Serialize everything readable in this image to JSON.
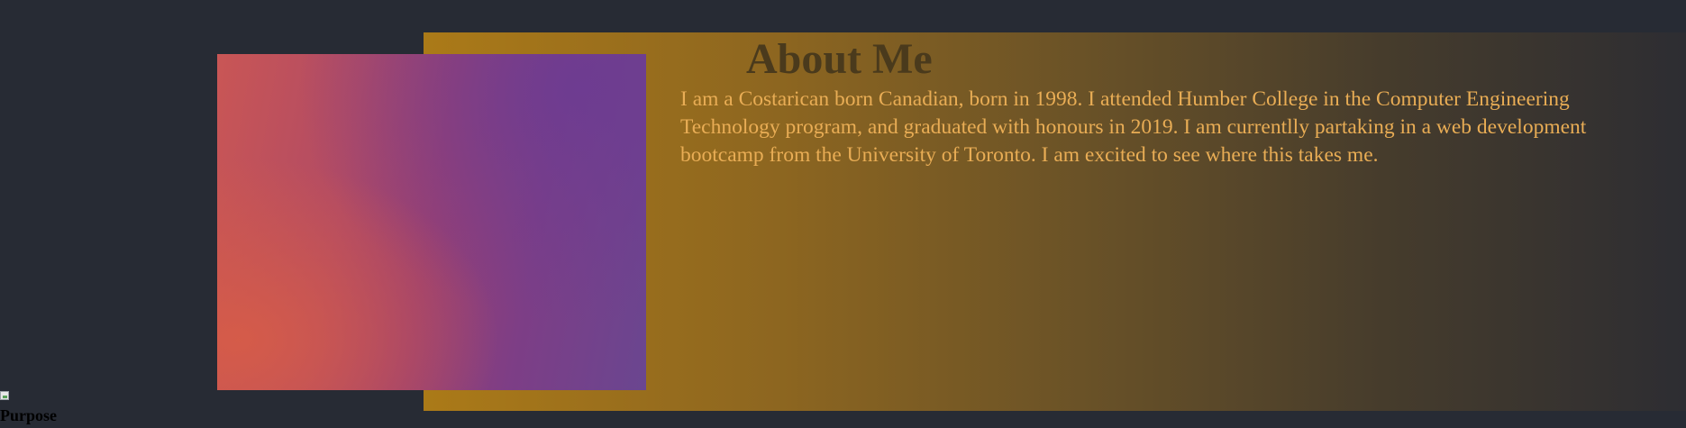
{
  "about": {
    "title": "About Me",
    "text": "I am a Costarican born Canadian, born in 1998. I attended Humber College in the Computer Engineering Technology program, and graduated with honours in 2019. I am currentlly partaking in a web development bootcamp from the University of Toronto. I am excited to see where this takes me."
  },
  "purpose_image": {
    "alt": "Purpose",
    "icon": "broken-image-icon"
  },
  "colors": {
    "background": "#272b34",
    "panel_gradient_start": "#ab7a18",
    "panel_gradient_end": "#2d2d32",
    "heading": "#4a3a1c",
    "body_text": "#e9ad55"
  }
}
